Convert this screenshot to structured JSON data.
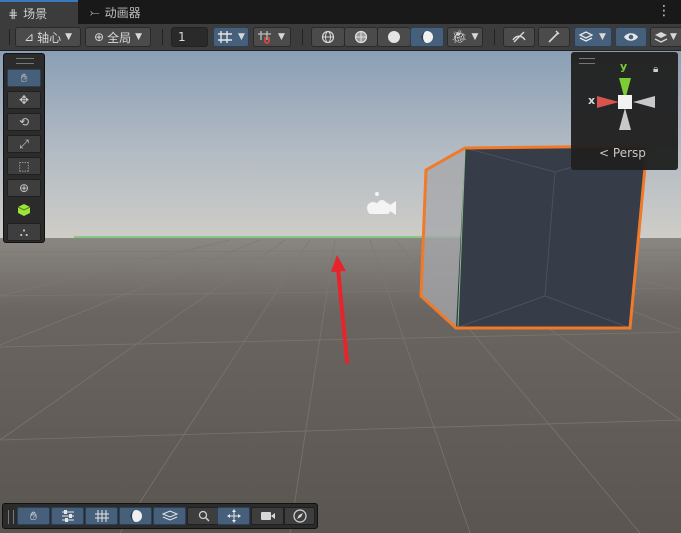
{
  "tabs": [
    {
      "label": "场景",
      "icon": "grid-icon",
      "active": true
    },
    {
      "label": "动画器",
      "icon": "animator-icon",
      "active": false
    }
  ],
  "toolbar": {
    "pivot_label": "轴心",
    "space_label": "全局",
    "grid_size_value": "1",
    "shading_modes": [
      "wireframe",
      "shaded-wire",
      "shaded",
      "unlit"
    ],
    "selected_shading": "unlit"
  },
  "gizmo": {
    "y_label": "y",
    "x_label": "x",
    "persp_label": "Persp"
  },
  "colors": {
    "accent": "#46607c",
    "selection_outline": "#f07a2a",
    "annotation_arrow": "#e8232b",
    "horizon_line": "#3ec23e"
  },
  "bottom_tools": [
    "hand-tool",
    "inspector-toggle",
    "grid-toggle",
    "lighting-toggle",
    "layers-toggle",
    "search-toggle",
    "move-toggle",
    "camera-toggle",
    "navigation-toggle"
  ]
}
